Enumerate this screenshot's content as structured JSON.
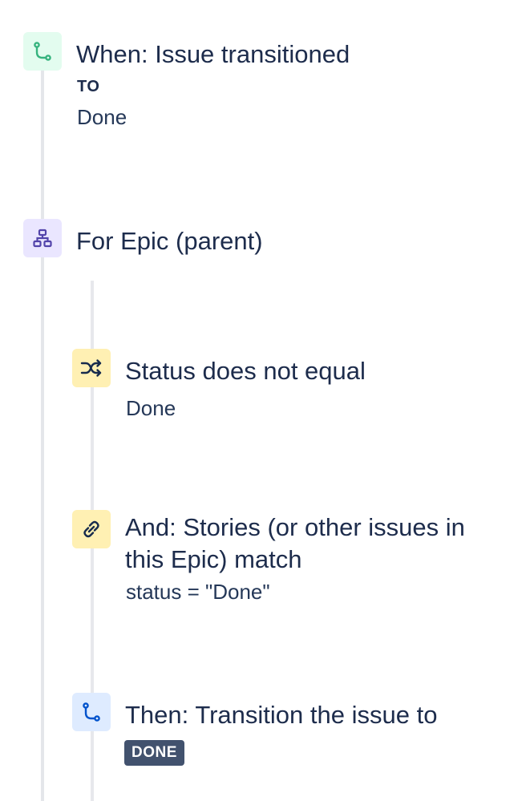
{
  "trigger": {
    "icon": "transition-icon",
    "title": "When: Issue transitioned",
    "to_label": "TO",
    "to_value": "Done",
    "icon_color": "#36b37e"
  },
  "branch": {
    "icon": "hierarchy-icon",
    "title": "For Epic (parent)",
    "icon_color": "#5243aa"
  },
  "conditions": [
    {
      "icon": "shuffle-icon",
      "title": "Status does not equal",
      "detail": "Done",
      "icon_color": "#172b4d"
    },
    {
      "icon": "link-icon",
      "title": "And: Stories (or other issues in this Epic) match",
      "detail": "status = \"Done\"",
      "icon_color": "#172b4d"
    }
  ],
  "action": {
    "icon": "transition-icon",
    "title": "Then: Transition the issue to",
    "status_lozenge": "DONE",
    "icon_color": "#0052cc"
  }
}
